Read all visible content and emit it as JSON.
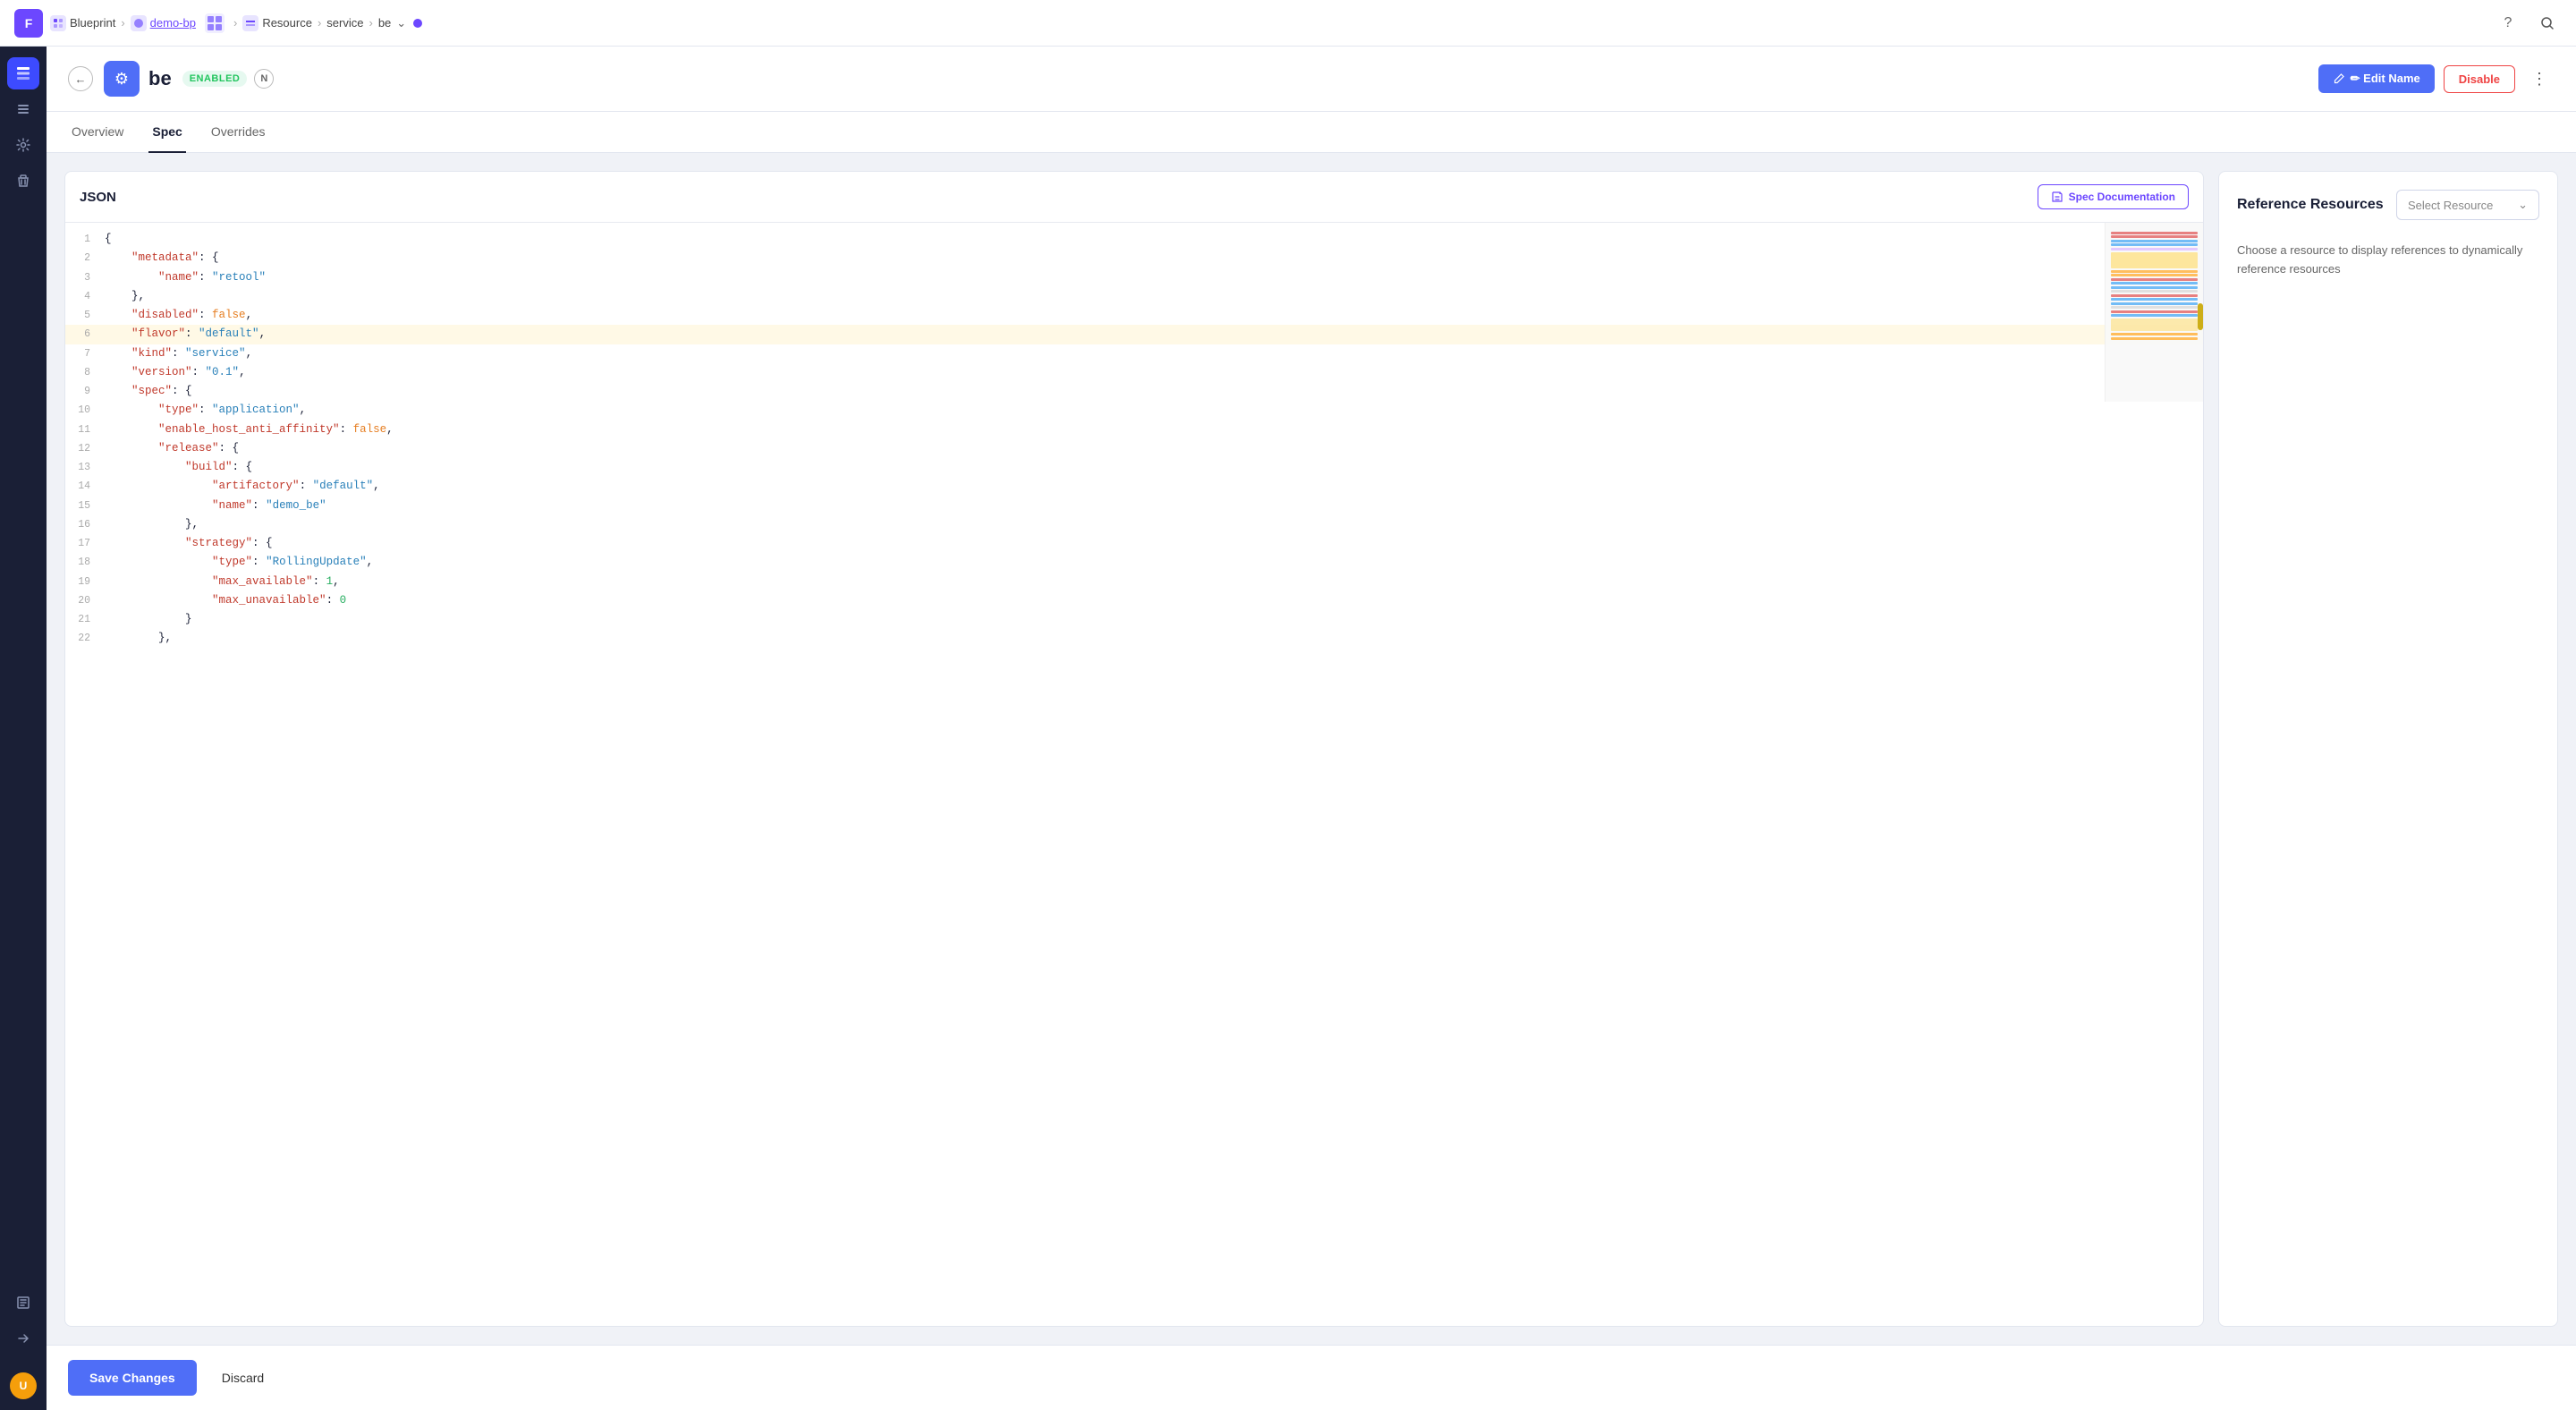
{
  "topbar": {
    "logo": "F",
    "breadcrumbs": [
      {
        "icon": "blueprint-icon",
        "iconType": "blueprint",
        "label": "Blueprint",
        "separator": true
      },
      {
        "icon": "demo-bp-icon",
        "iconType": "service",
        "label": "demo-bp",
        "link": true,
        "separator": true,
        "hasGrid": true
      },
      {
        "icon": "resource-icon",
        "iconType": "resource",
        "label": "Resource",
        "separator": true
      },
      {
        "icon": "table-icon",
        "iconType": "table",
        "label": "service",
        "separator": true
      },
      {
        "label": "be",
        "separator": false,
        "hasDropdown": true
      }
    ],
    "helpBtn": "?",
    "searchBtn": "🔍"
  },
  "sidebar": {
    "items": [
      {
        "id": "layers",
        "icon": "⊞",
        "active": true
      },
      {
        "id": "list",
        "icon": "☰",
        "active": false
      },
      {
        "id": "settings",
        "icon": "⚙",
        "active": false
      },
      {
        "id": "trash",
        "icon": "🗑",
        "active": false
      },
      {
        "id": "book",
        "icon": "📖",
        "active": false
      },
      {
        "id": "arrow",
        "icon": "→",
        "active": false
      }
    ],
    "avatar": "U"
  },
  "resourceHeader": {
    "backLabel": "←",
    "iconLabel": "⚙",
    "name": "be",
    "status": "ENABLED",
    "nBadge": "N",
    "editNameLabel": "✏ Edit Name",
    "disableLabel": "Disable",
    "moreLabel": "⋮"
  },
  "tabs": [
    {
      "id": "overview",
      "label": "Overview",
      "active": false
    },
    {
      "id": "spec",
      "label": "Spec",
      "active": true
    },
    {
      "id": "overrides",
      "label": "Overrides",
      "active": false
    }
  ],
  "editor": {
    "title": "JSON",
    "specDocBtn": "Spec Documentation",
    "lines": [
      {
        "num": 1,
        "content": "{"
      },
      {
        "num": 2,
        "content": "  \"metadata\": {"
      },
      {
        "num": 3,
        "content": "    \"name\": \"retool\""
      },
      {
        "num": 4,
        "content": "  },"
      },
      {
        "num": 5,
        "content": "  \"disabled\": false,"
      },
      {
        "num": 6,
        "content": "  \"flavor\": \"default\","
      },
      {
        "num": 7,
        "content": "  \"kind\": \"service\","
      },
      {
        "num": 8,
        "content": "  \"version\": \"0.1\","
      },
      {
        "num": 9,
        "content": "  \"spec\": {"
      },
      {
        "num": 10,
        "content": "    \"type\": \"application\","
      },
      {
        "num": 11,
        "content": "    \"enable_host_anti_affinity\": false,"
      },
      {
        "num": 12,
        "content": "    \"release\": {"
      },
      {
        "num": 13,
        "content": "      \"build\": {"
      },
      {
        "num": 14,
        "content": "        \"artifactory\": \"default\","
      },
      {
        "num": 15,
        "content": "        \"name\": \"demo_be\""
      },
      {
        "num": 16,
        "content": "      },"
      },
      {
        "num": 17,
        "content": "      \"strategy\": {"
      },
      {
        "num": 18,
        "content": "        \"type\": \"RollingUpdate\","
      },
      {
        "num": 19,
        "content": "        \"max_available\": 1,"
      },
      {
        "num": 20,
        "content": "        \"max_unavailable\": 0"
      },
      {
        "num": 21,
        "content": "      }"
      },
      {
        "num": 22,
        "content": "    },"
      }
    ]
  },
  "refPanel": {
    "title": "Reference Resources",
    "selectLabel": "Select Resource",
    "description": "Choose a resource to display references to dynamically reference resources"
  },
  "bottomBar": {
    "saveLabel": "Save Changes",
    "discardLabel": "Discard"
  }
}
